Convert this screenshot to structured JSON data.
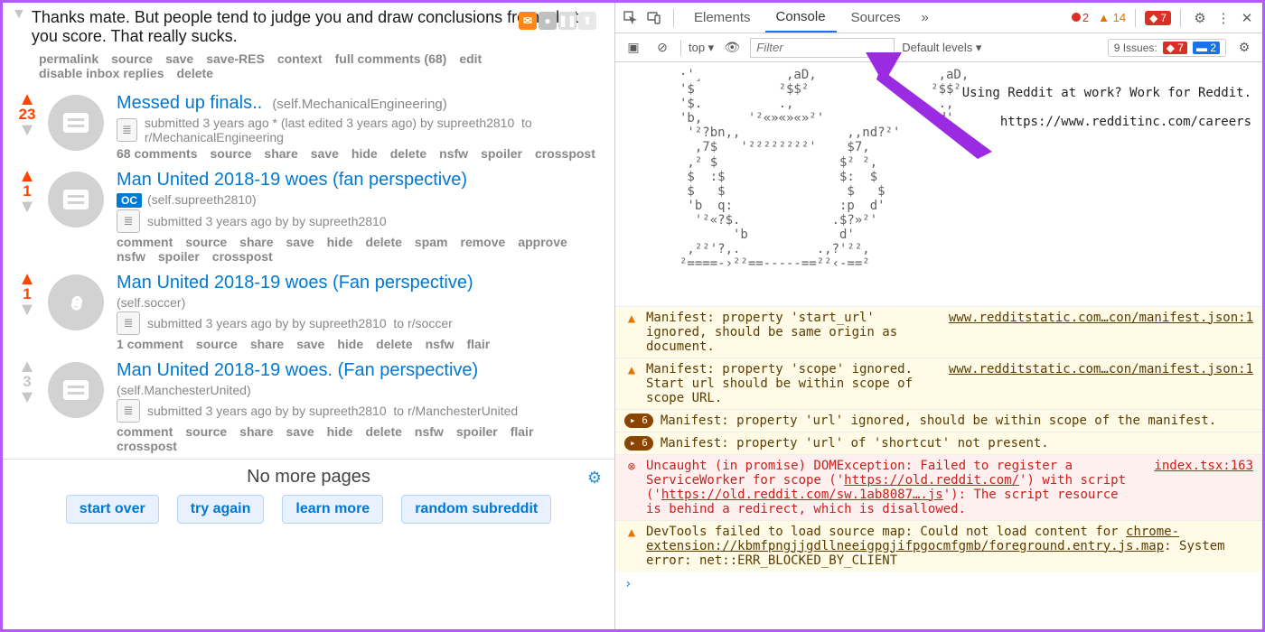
{
  "comment": {
    "body": "Thanks mate. But people tend to judge you and draw conclusions from what you score. That really sucks.",
    "actions": [
      "permalink",
      "source",
      "save",
      "save-RES",
      "context",
      "full comments (68)",
      "edit",
      "disable inbox replies",
      "delete"
    ]
  },
  "posts": [
    {
      "score": "23",
      "orange": true,
      "thumb": "doc",
      "title": "Messed up finals..",
      "domain": "(self.MechanicalEngineering)",
      "oc": false,
      "submitted": "submitted 3 years ago * ",
      "edited_note": "(last edited 3 years ago) ",
      "by": "supreeth2810",
      "to_label": "to",
      "to_sub": "r/MechanicalEngineering",
      "actions": [
        "68 comments",
        "source",
        "share",
        "save",
        "hide",
        "delete",
        "nsfw",
        "spoiler",
        "crosspost"
      ]
    },
    {
      "score": "1",
      "orange": true,
      "thumb": "doc",
      "title": "Man United 2018-19 woes (fan perspective)",
      "domain": "(self.supreeth2810)",
      "oc": true,
      "submitted": "submitted 3 years ago by ",
      "by": "supreeth2810",
      "actions": [
        "comment",
        "source",
        "share",
        "save",
        "hide",
        "delete",
        "spam",
        "remove",
        "approve",
        "nsfw",
        "spoiler",
        "crosspost"
      ]
    },
    {
      "score": "1",
      "orange": true,
      "thumb": "link",
      "title": "Man United 2018-19 woes (Fan perspective)",
      "domain": "(self.soccer)",
      "oc": false,
      "submitted": "submitted 3 years ago by ",
      "by": "supreeth2810",
      "to_label": "to",
      "to_sub": "r/soccer",
      "actions": [
        "1 comment",
        "source",
        "share",
        "save",
        "hide",
        "delete",
        "nsfw",
        "flair"
      ]
    },
    {
      "score": "3",
      "orange": false,
      "thumb": "doc",
      "title": "Man United 2018-19 woes. (Fan perspective)",
      "domain": "(self.ManchesterUnited)",
      "oc": false,
      "submitted": "submitted 3 years ago by ",
      "by": "supreeth2810",
      "to_label": "to",
      "to_sub": "r/ManchesterUnited",
      "actions": [
        "comment",
        "source",
        "share",
        "save",
        "hide",
        "delete",
        "nsfw",
        "spoiler",
        "flair",
        "crosspost"
      ]
    }
  ],
  "bottom": {
    "msg": "No more pages",
    "buttons": [
      "start over",
      "try again",
      "learn more",
      "random subreddit"
    ]
  },
  "devtools": {
    "tabs": {
      "elements": "Elements",
      "console": "Console",
      "sources": "Sources",
      "more": "»"
    },
    "error_count": "2",
    "warn_count": "14",
    "blocker_count": "7",
    "toolbar": {
      "context": "top ▾",
      "filter_placeholder": "Filter",
      "levels": "Default levels ▾",
      "issues_label": "9 Issues:",
      "issues_red": "7",
      "issues_blue": "2"
    },
    "ascii": "       ·'¸           ,aD,                ,aD,\n       '$           ²$$²                ²$$²\n       '$.          .,                   .,\n       'b,      '²«»«»«»²'              ,d'\n        '²?bn,,              ,,nd?²'\n         ,7$   '²²²²²²²²'    $7,\n        ,² $                $² ²,\n        $  :$               $:  $\n        $   $                $   $\n        'b  q:              :p  d'\n         '²«?$.            .$?»²'\n              'b            d'\n        ,²²'?,.          .,?'²²,\n       ²====-›²²==-----==²²‹-==²",
    "promo_text": "Using Reddit at work? Work for Reddit.",
    "promo_link": "https://www.redditinc.com/careers",
    "rows": [
      {
        "kind": "warn",
        "msg_pre": "Manifest: property 'start_url' ignored, should be same origin as document.",
        "src": "www.redditstatic.com…con/manifest.json:1"
      },
      {
        "kind": "warn",
        "msg_pre": "Manifest: property 'scope' ignored. Start url should be within scope of scope URL.",
        "src": "www.redditstatic.com…con/manifest.json:1"
      },
      {
        "kind": "warn",
        "pill": "6",
        "msg_pre": "Manifest: property 'url' ignored, should be within scope of the manifest."
      },
      {
        "kind": "warn",
        "pill": "6",
        "msg_pre": "Manifest: property 'url' of 'shortcut' not present."
      },
      {
        "kind": "err",
        "msg_pre": "Uncaught (in promise) DOMException: Failed to register a ServiceWorker for scope ('",
        "url1": "https://old.reddit.com/",
        "msg_mid": "') with script ('",
        "url2": "https://old.reddit.com/sw.1ab8087….js",
        "msg_post": "'): The script resource is behind a redirect, which is disallowed.",
        "src": "index.tsx:163"
      },
      {
        "kind": "warn",
        "msg_pre": "DevTools failed to load source map: Could not load content for ",
        "url1": "chrome-extension://kbmfpngjjgdllneeigpgjifpgocmfgmb/foreground.entry.js.map",
        "msg_post": ": System error: net::ERR_BLOCKED_BY_CLIENT"
      }
    ],
    "prompt": "›"
  }
}
